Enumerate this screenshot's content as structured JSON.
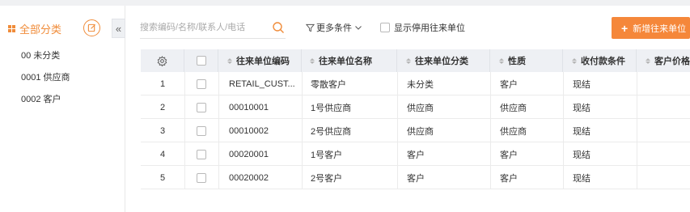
{
  "sidebar": {
    "title": "全部分类",
    "categories": [
      {
        "label": "00 未分类"
      },
      {
        "label": "0001 供应商"
      },
      {
        "label": "0002 客户"
      }
    ]
  },
  "toolbar": {
    "search_placeholder": "搜索编码/名称/联系人/电话",
    "more_conditions": "更多条件",
    "show_disabled": "显示停用往来单位",
    "add_button": "新增往来单位"
  },
  "table": {
    "headers": [
      "往来单位编码",
      "往来单位名称",
      "往来单位分类",
      "性质",
      "收付款条件",
      "客户价格"
    ],
    "rows": [
      {
        "no": "1",
        "code": "RETAIL_CUST...",
        "name": "零散客户",
        "category": "未分类",
        "nature": "客户",
        "terms": "现结"
      },
      {
        "no": "2",
        "code": "00010001",
        "name": "1号供应商",
        "category": "供应商",
        "nature": "供应商",
        "terms": "现结"
      },
      {
        "no": "3",
        "code": "00010002",
        "name": "2号供应商",
        "category": "供应商",
        "nature": "供应商",
        "terms": "现结"
      },
      {
        "no": "4",
        "code": "00020001",
        "name": "1号客户",
        "category": "客户",
        "nature": "客户",
        "terms": "现结"
      },
      {
        "no": "5",
        "code": "00020002",
        "name": "2号客户",
        "category": "客户",
        "nature": "客户",
        "terms": "现结"
      }
    ]
  },
  "colors": {
    "accent": "#f5873a",
    "header_bg": "#eef0f4"
  },
  "icons": [
    "grid-icon",
    "edit-icon",
    "collapse-icon",
    "search-icon",
    "filter-icon",
    "chevron-down-icon",
    "settings-icon",
    "sort-icon",
    "plus-icon"
  ]
}
